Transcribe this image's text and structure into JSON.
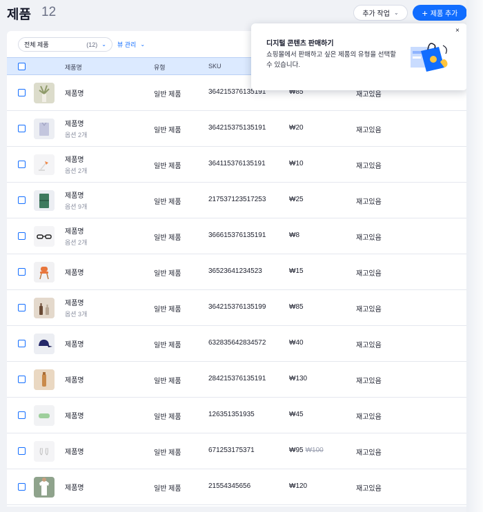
{
  "header": {
    "title": "제품",
    "count": "12",
    "more_actions_label": "추가 작업",
    "add_product_label": "제품 추가"
  },
  "toolbar": {
    "filter_label": "전체 제품",
    "filter_count": "(12)",
    "view_label": "뷰 관리"
  },
  "table": {
    "columns": [
      "제품명",
      "유형",
      "SKU"
    ],
    "rows": [
      {
        "name": "제품명",
        "variants": "",
        "type": "일반 제품",
        "sku": "364215376135191",
        "price": "₩85",
        "old_price": "",
        "stock": "재고있음",
        "thumb": "plant-vase-icon"
      },
      {
        "name": "제품명",
        "variants": "옵션 2개",
        "type": "일반 제품",
        "sku": "364215375135191",
        "price": "₩20",
        "old_price": "",
        "stock": "재고있음",
        "thumb": "folded-shirt-icon"
      },
      {
        "name": "제품명",
        "variants": "옵션 2개",
        "type": "일반 제품",
        "sku": "364115376135191",
        "price": "₩10",
        "old_price": "",
        "stock": "재고있음",
        "thumb": "lamp-icon"
      },
      {
        "name": "제품명",
        "variants": "옵션 9개",
        "type": "일반 제품",
        "sku": "217537123517253",
        "price": "₩25",
        "old_price": "",
        "stock": "재고있음",
        "thumb": "green-shirt-icon"
      },
      {
        "name": "제품명",
        "variants": "옵션 2개",
        "type": "일반 제품",
        "sku": "366615376135191",
        "price": "₩8",
        "old_price": "",
        "stock": "재고있음",
        "thumb": "glasses-icon"
      },
      {
        "name": "제품명",
        "variants": "",
        "type": "일반 제품",
        "sku": "36523641234523",
        "price": "₩15",
        "old_price": "",
        "stock": "재고있음",
        "thumb": "chair-icon"
      },
      {
        "name": "제품명",
        "variants": "옵션 3개",
        "type": "일반 제품",
        "sku": "364215376135199",
        "price": "₩85",
        "old_price": "",
        "stock": "재고있음",
        "thumb": "bottles-icon"
      },
      {
        "name": "제품명",
        "variants": "",
        "type": "일반 제품",
        "sku": "632835642834572",
        "price": "₩40",
        "old_price": "",
        "stock": "재고있음",
        "thumb": "cap-icon"
      },
      {
        "name": "제품명",
        "variants": "",
        "type": "일반 제품",
        "sku": "284215376135191",
        "price": "₩130",
        "old_price": "",
        "stock": "재고있음",
        "thumb": "bottle-icon"
      },
      {
        "name": "제품명",
        "variants": "",
        "type": "일반 제품",
        "sku": "126351351935",
        "price": "₩45",
        "old_price": "",
        "stock": "재고있음",
        "thumb": "soap-icon"
      },
      {
        "name": "제품명",
        "variants": "",
        "type": "일반 제품",
        "sku": "671253175371",
        "price": "₩95",
        "old_price": "₩100",
        "stock": "재고있음",
        "thumb": "earrings-icon"
      },
      {
        "name": "제품명",
        "variants": "",
        "type": "일반 제품",
        "sku": "21554345656",
        "price": "₩120",
        "old_price": "",
        "stock": "재고있음",
        "thumb": "tshirt-icon"
      }
    ]
  },
  "popover": {
    "title": "디지털 콘텐츠 판매하기",
    "body": "쇼핑몰에서 판매하고 싶은 제품의 유형을 선택할 수 있습니다.",
    "close": "×"
  },
  "colors": {
    "accent": "#116dff",
    "header_row": "#dceaff",
    "background": "#f0f2f6"
  }
}
